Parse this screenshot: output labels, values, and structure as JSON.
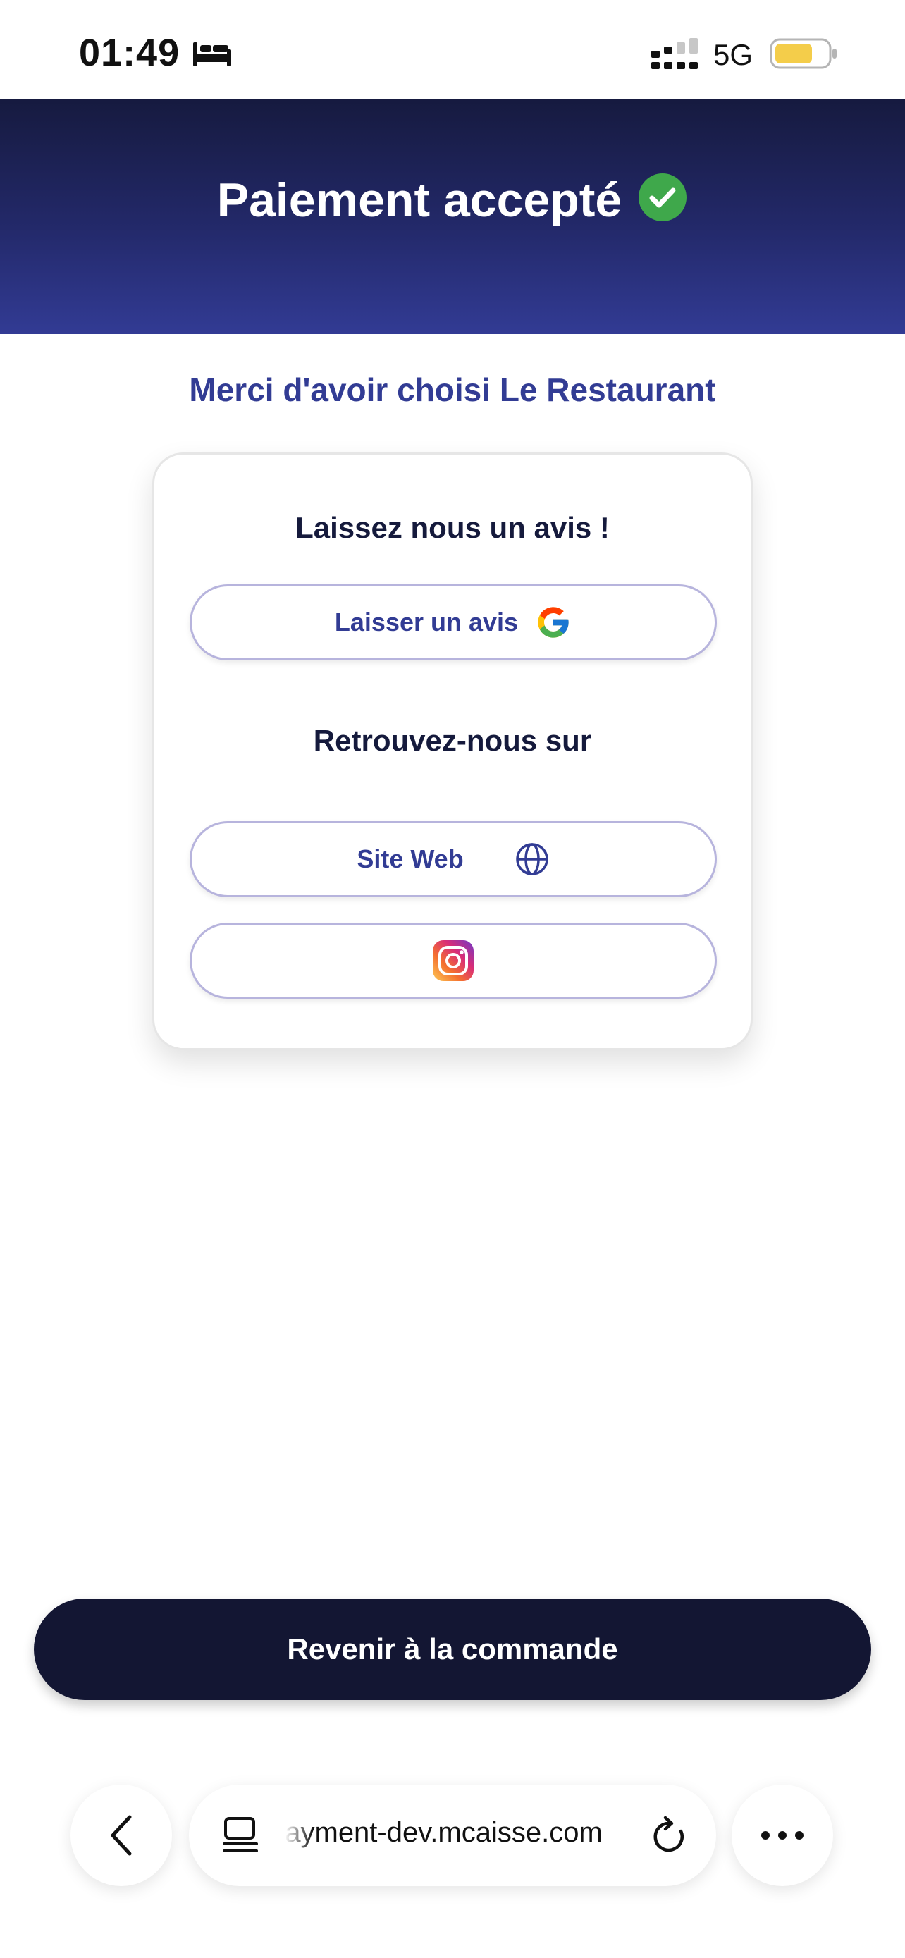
{
  "status_bar": {
    "time": "01:49",
    "network": "5G",
    "icons": [
      "bed-icon",
      "signal-icon",
      "battery-icon"
    ],
    "battery_color": "#f4cd4a"
  },
  "header": {
    "title": "Paiement accepté",
    "icon": "check-circle-icon",
    "check_color": "#3fa84b",
    "gradient_top": "#161a3f",
    "gradient_bottom": "#323b94"
  },
  "thanks": "Merci d'avoir choisi Le Restaurant",
  "card": {
    "review_heading": "Laissez nous un avis !",
    "review_button": {
      "label": "Laisser un avis",
      "icon": "google-icon"
    },
    "social_heading": "Retrouvez-nous sur",
    "website_button": {
      "label": "Site Web",
      "icon": "globe-icon"
    },
    "instagram_button": {
      "icon": "instagram-icon"
    }
  },
  "return_button": {
    "label": "Revenir à la commande",
    "color": "#131633"
  },
  "browser": {
    "url": "payment-dev.mcaisse.com",
    "icons": [
      "back-icon",
      "tabs-icon",
      "reload-icon",
      "more-icon"
    ]
  },
  "accent_color": "#323c94"
}
